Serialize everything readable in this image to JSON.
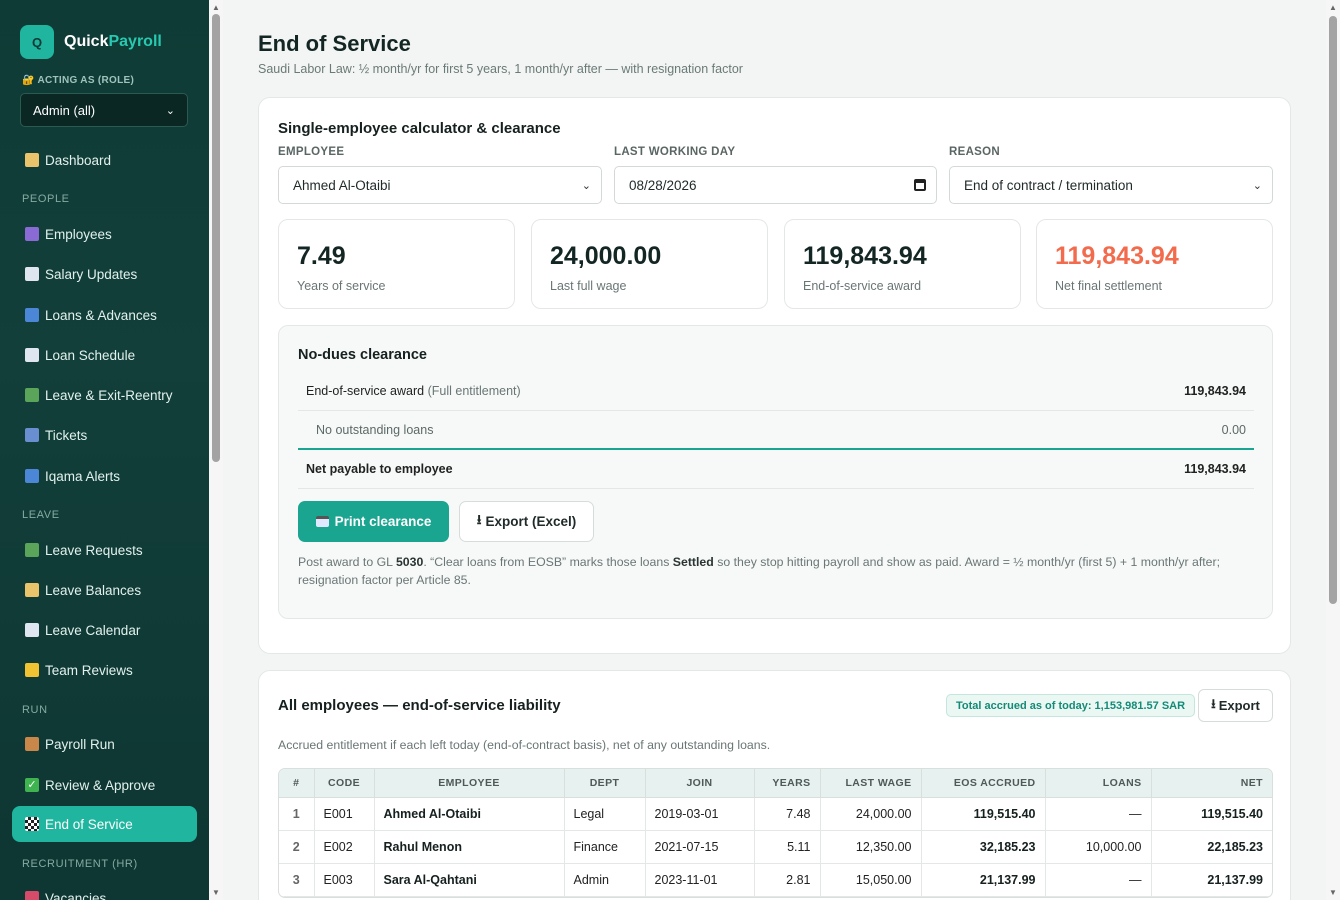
{
  "brand": {
    "logo_letter": "Q",
    "name_part1": "Quick",
    "name_part2": "Payroll"
  },
  "role": {
    "label": "🔐 ACTING AS (ROLE)",
    "value": "Admin (all)"
  },
  "nav": {
    "dashboard": "Dashboard",
    "section_people": "PEOPLE",
    "employees": "Employees",
    "salary_updates": "Salary Updates",
    "loans_advances": "Loans & Advances",
    "loan_schedule": "Loan Schedule",
    "leave_exit_reentry": "Leave & Exit-Reentry",
    "tickets": "Tickets",
    "iqama_alerts": "Iqama Alerts",
    "section_leave": "LEAVE",
    "leave_requests": "Leave Requests",
    "leave_balances": "Leave Balances",
    "leave_calendar": "Leave Calendar",
    "team_reviews": "Team Reviews",
    "section_run": "RUN",
    "payroll_run": "Payroll Run",
    "review_approve": "Review & Approve",
    "end_of_service": "End of Service",
    "section_recruitment": "RECRUITMENT (HR)",
    "vacancies": "Vacancies"
  },
  "page": {
    "title": "End of Service",
    "subtitle": "Saudi Labor Law: ½ month/yr for first 5 years, 1 month/yr after — with resignation factor"
  },
  "calculator": {
    "title": "Single-employee calculator & clearance",
    "employee_label": "EMPLOYEE",
    "employee_value": "Ahmed Al-Otaibi",
    "last_day_label": "LAST WORKING DAY",
    "last_day_value": "08/28/2026",
    "reason_label": "REASON",
    "reason_value": "End of contract / termination",
    "stats": [
      {
        "value": "7.49",
        "label": "Years of service"
      },
      {
        "value": "24,000.00",
        "label": "Last full wage"
      },
      {
        "value": "119,843.94",
        "label": "End-of-service award"
      },
      {
        "value": "119,843.94",
        "label": "Net final settlement"
      }
    ],
    "clearance": {
      "title": "No-dues clearance",
      "award_label": "End-of-service award",
      "award_note": "(Full entitlement)",
      "award_amount": "119,843.94",
      "loans_label": "No outstanding loans",
      "loans_amount": "0.00",
      "net_label": "Net payable to employee",
      "net_amount": "119,843.94",
      "print_label": "Print clearance",
      "export_label": "Export (Excel)",
      "note_1": "Post award to GL ",
      "note_gl": "5030",
      "note_2": ". “Clear loans from EOSB” marks those loans ",
      "note_settled": "Settled",
      "note_3": " so they stop hitting payroll and show as paid. Award = ½ month/yr (first 5) + 1 month/yr after; resignation factor per Article 85."
    }
  },
  "liability": {
    "title": "All employees — end-of-service liability",
    "badge": "Total accrued as of today: 1,153,981.57 SAR",
    "export_label": "Export",
    "note": "Accrued entitlement if each left today (end-of-contract basis), net of any outstanding loans.",
    "columns": [
      "#",
      "CODE",
      "EMPLOYEE",
      "DEPT",
      "JOIN",
      "YEARS",
      "LAST WAGE",
      "EOS ACCRUED",
      "LOANS",
      "NET"
    ],
    "rows": [
      {
        "idx": "1",
        "code": "E001",
        "name": "Ahmed Al-Otaibi",
        "dept": "Legal",
        "join": "2019-03-01",
        "years": "7.48",
        "wage": "24,000.00",
        "eos": "119,515.40",
        "loans": "—",
        "net": "119,515.40"
      },
      {
        "idx": "2",
        "code": "E002",
        "name": "Rahul Menon",
        "dept": "Finance",
        "join": "2021-07-15",
        "years": "5.11",
        "wage": "12,350.00",
        "eos": "32,185.23",
        "loans": "10,000.00",
        "net": "22,185.23"
      },
      {
        "idx": "3",
        "code": "E003",
        "name": "Sara Al-Qahtani",
        "dept": "Admin",
        "join": "2023-11-01",
        "years": "2.81",
        "wage": "15,050.00",
        "eos": "21,137.99",
        "loans": "—",
        "net": "21,137.99"
      }
    ]
  },
  "colors": {
    "accent": "#1aa590",
    "sidebar": "#0f3b36",
    "danger": "#f26b4c"
  }
}
